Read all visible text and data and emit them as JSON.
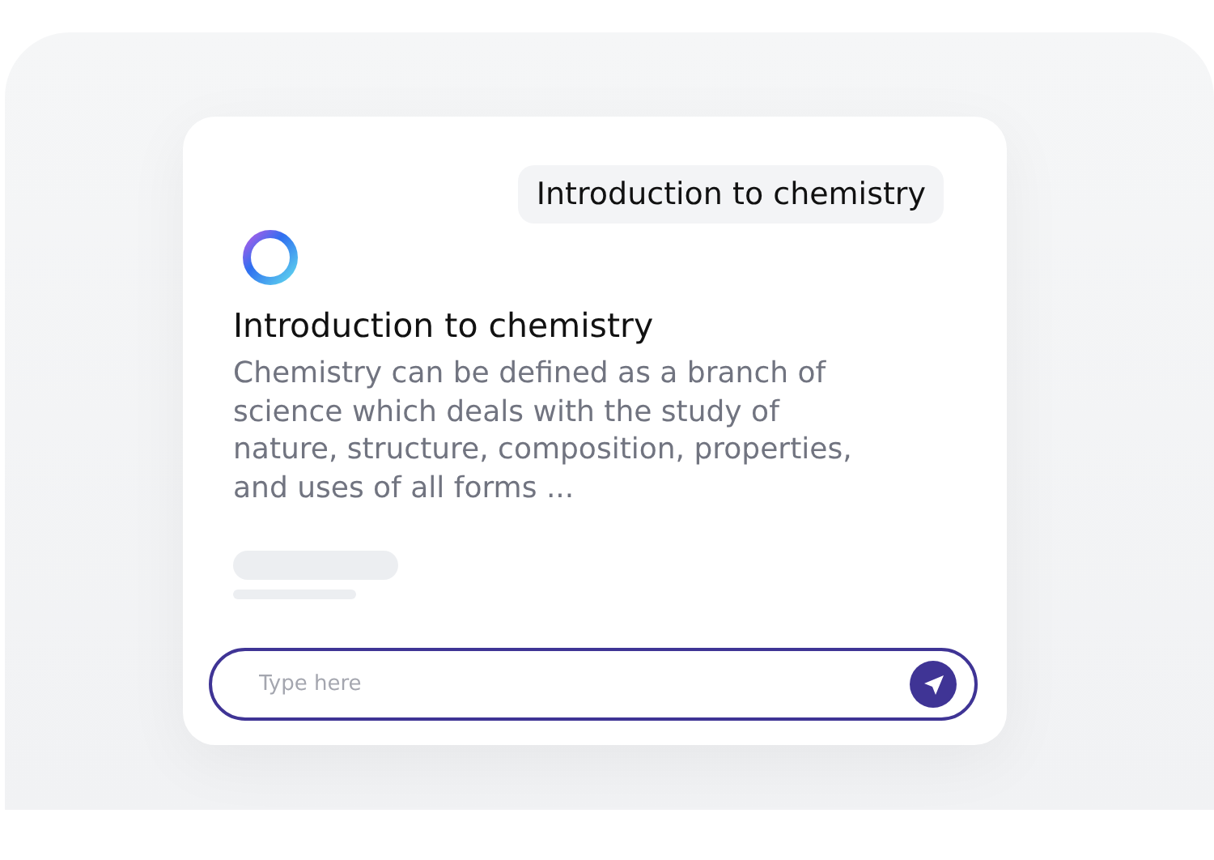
{
  "chat": {
    "user_message": "Introduction to chemistry",
    "reply": {
      "title": "Introduction to chemistry",
      "body": "Chemistry can be defined as a branch of science which deals with the study of nature, structure, composition, properties, and uses of all forms ..."
    },
    "loading": true,
    "input": {
      "placeholder": "Type here"
    }
  }
}
